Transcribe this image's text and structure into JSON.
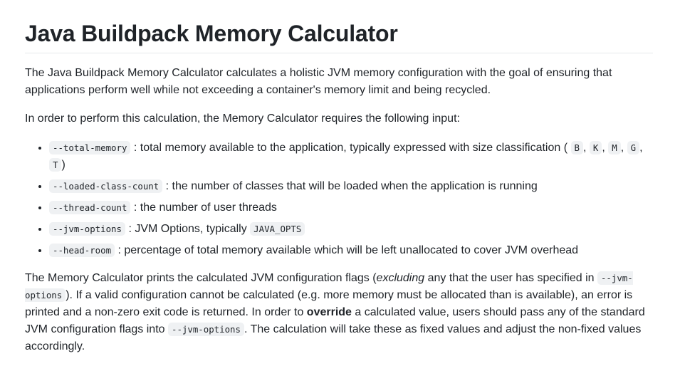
{
  "title": "Java Buildpack Memory Calculator",
  "intro": "The Java Buildpack Memory Calculator calculates a holistic JVM memory configuration with the goal of ensuring that applications perform well while not exceeding a container's memory limit and being recycled.",
  "input_intro": "In order to perform this calculation, the Memory Calculator requires the following input:",
  "inputs": [
    {
      "flag": "--total-memory",
      "desc": ": total memory available to the application, typically expressed with size classification (",
      "units": [
        "B",
        "K",
        "M",
        "G",
        "T"
      ],
      "close": ")"
    },
    {
      "flag": "--loaded-class-count",
      "desc": ": the number of classes that will be loaded when the application is running"
    },
    {
      "flag": "--thread-count",
      "desc": ": the number of user threads"
    },
    {
      "flag": "--jvm-options",
      "desc": ": JVM Options, typically ",
      "code": "JAVA_OPTS"
    },
    {
      "flag": "--head-room",
      "desc": ": percentage of total memory available which will be left unallocated to cover JVM overhead"
    }
  ],
  "outro": {
    "part1": "The Memory Calculator prints the calculated JVM configuration flags (",
    "em": "excluding",
    "part2": " any that the user has specified in ",
    "code1": "--jvm-options",
    "part3": "). If a valid configuration cannot be calculated (e.g. more memory must be allocated than is available), an error is printed and a non-zero exit code is returned. In order to ",
    "strong": "override",
    "part4": " a calculated value, users should pass any of the standard JVM configuration flags into ",
    "code2": "--jvm-options",
    "part5": ". The calculation will take these as fixed values and adjust the non-fixed values accordingly."
  }
}
